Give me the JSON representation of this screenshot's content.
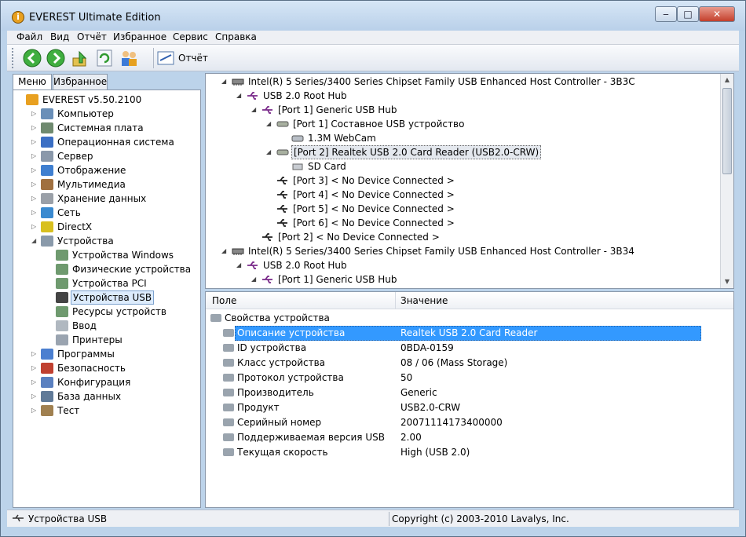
{
  "window": {
    "title": "EVEREST Ultimate Edition",
    "controls": {
      "minimize": "‒",
      "maximize": "□",
      "close": "✕"
    }
  },
  "menu": [
    "Файл",
    "Вид",
    "Отчёт",
    "Избранное",
    "Сервис",
    "Справка"
  ],
  "toolbar": {
    "buttons": [
      "back-icon",
      "forward-icon",
      "up-icon",
      "refresh-icon",
      "users-icon",
      "report-icon"
    ],
    "report_label": "Отчёт"
  },
  "tabs": [
    "Меню",
    "Избранное"
  ],
  "left_tree": [
    {
      "label": "EVEREST v5.50.2100",
      "icon": "everest-icon",
      "expander": ""
    },
    {
      "label": "Компьютер",
      "icon": "computer-icon",
      "expander": "▷"
    },
    {
      "label": "Системная плата",
      "icon": "motherboard-icon",
      "expander": "▷"
    },
    {
      "label": "Операционная система",
      "icon": "windows-icon",
      "expander": "▷"
    },
    {
      "label": "Сервер",
      "icon": "server-icon",
      "expander": "▷"
    },
    {
      "label": "Отображение",
      "icon": "display-icon",
      "expander": "▷"
    },
    {
      "label": "Мультимедиа",
      "icon": "multimedia-icon",
      "expander": "▷"
    },
    {
      "label": "Хранение данных",
      "icon": "storage-icon",
      "expander": "▷"
    },
    {
      "label": "Сеть",
      "icon": "network-icon",
      "expander": "▷"
    },
    {
      "label": "DirectX",
      "icon": "directx-icon",
      "expander": "▷"
    },
    {
      "label": "Устройства",
      "icon": "devices-icon",
      "expander": "◢"
    },
    {
      "label": "Устройства Windows",
      "icon": "device-card-icon",
      "expander": ""
    },
    {
      "label": "Физические устройства",
      "icon": "device-card-icon",
      "expander": ""
    },
    {
      "label": "Устройства PCI",
      "icon": "device-card-icon",
      "expander": ""
    },
    {
      "label": "Устройства USB",
      "icon": "usb-icon",
      "expander": ""
    },
    {
      "label": "Ресурсы устройств",
      "icon": "device-card-icon",
      "expander": ""
    },
    {
      "label": "Ввод",
      "icon": "input-icon",
      "expander": ""
    },
    {
      "label": "Принтеры",
      "icon": "printer-icon",
      "expander": ""
    },
    {
      "label": "Программы",
      "icon": "programs-icon",
      "expander": "▷"
    },
    {
      "label": "Безопасность",
      "icon": "security-icon",
      "expander": "▷"
    },
    {
      "label": "Конфигурация",
      "icon": "config-icon",
      "expander": "▷"
    },
    {
      "label": "База данных",
      "icon": "database-icon",
      "expander": "▷"
    },
    {
      "label": "Тест",
      "icon": "test-icon",
      "expander": "▷"
    }
  ],
  "usb_tree": [
    {
      "label": "Intel(R) 5 Series/3400 Series Chipset Family USB Enhanced Host Controller - 3B3C",
      "icon": "controller-icon",
      "expander": "◢"
    },
    {
      "label": "USB 2.0 Root Hub",
      "icon": "usb-hub-icon",
      "expander": "◢"
    },
    {
      "label": "[Port 1] Generic USB Hub",
      "icon": "usb-hub-icon",
      "expander": "◢"
    },
    {
      "label": "[Port 1] Составное USB устройство",
      "icon": "usb-device-icon",
      "expander": "◢"
    },
    {
      "label": "1.3M WebCam",
      "icon": "webcam-icon",
      "expander": ""
    },
    {
      "label": "[Port 2] Realtek USB 2.0 Card Reader (USB2.0-CRW)",
      "icon": "usb-device-icon",
      "expander": "◢"
    },
    {
      "label": "SD Card",
      "icon": "drive-icon",
      "expander": ""
    },
    {
      "label": "[Port 3] < No Device Connected >",
      "icon": "usb-port-icon",
      "expander": ""
    },
    {
      "label": "[Port 4] < No Device Connected >",
      "icon": "usb-port-icon",
      "expander": ""
    },
    {
      "label": "[Port 5] < No Device Connected >",
      "icon": "usb-port-icon",
      "expander": ""
    },
    {
      "label": "[Port 6] < No Device Connected >",
      "icon": "usb-port-icon",
      "expander": ""
    },
    {
      "label": "[Port 2] < No Device Connected >",
      "icon": "usb-port-icon",
      "expander": ""
    },
    {
      "label": "Intel(R) 5 Series/3400 Series Chipset Family USB Enhanced Host Controller - 3B34",
      "icon": "controller-icon",
      "expander": "◢"
    },
    {
      "label": "USB 2.0 Root Hub",
      "icon": "usb-hub-icon",
      "expander": "◢"
    },
    {
      "label": "[Port 1] Generic USB Hub",
      "icon": "usb-hub-icon",
      "expander": "◢"
    }
  ],
  "properties": {
    "columns": [
      "Поле",
      "Значение"
    ],
    "group": "Свойства устройства",
    "rows": [
      {
        "field": "Описание устройства",
        "value": "Realtek USB 2.0 Card Reader"
      },
      {
        "field": "ID устройства",
        "value": "0BDA-0159"
      },
      {
        "field": "Класс устройства",
        "value": "08 / 06 (Mass Storage)"
      },
      {
        "field": "Протокол устройства",
        "value": "50"
      },
      {
        "field": "Производитель",
        "value": "Generic"
      },
      {
        "field": "Продукт",
        "value": "USB2.0-CRW"
      },
      {
        "field": "Серийный номер",
        "value": "20071114173400000"
      },
      {
        "field": "Поддерживаемая версия USB",
        "value": "2.00"
      },
      {
        "field": "Текущая скорость",
        "value": "High  (USB 2.0)"
      }
    ]
  },
  "status": {
    "left": "Устройства USB",
    "right": "Copyright (c) 2003-2010 Lavalys, Inc."
  },
  "colors": {
    "selection": "#3399ff",
    "window_frame": "#bcd3ea"
  }
}
